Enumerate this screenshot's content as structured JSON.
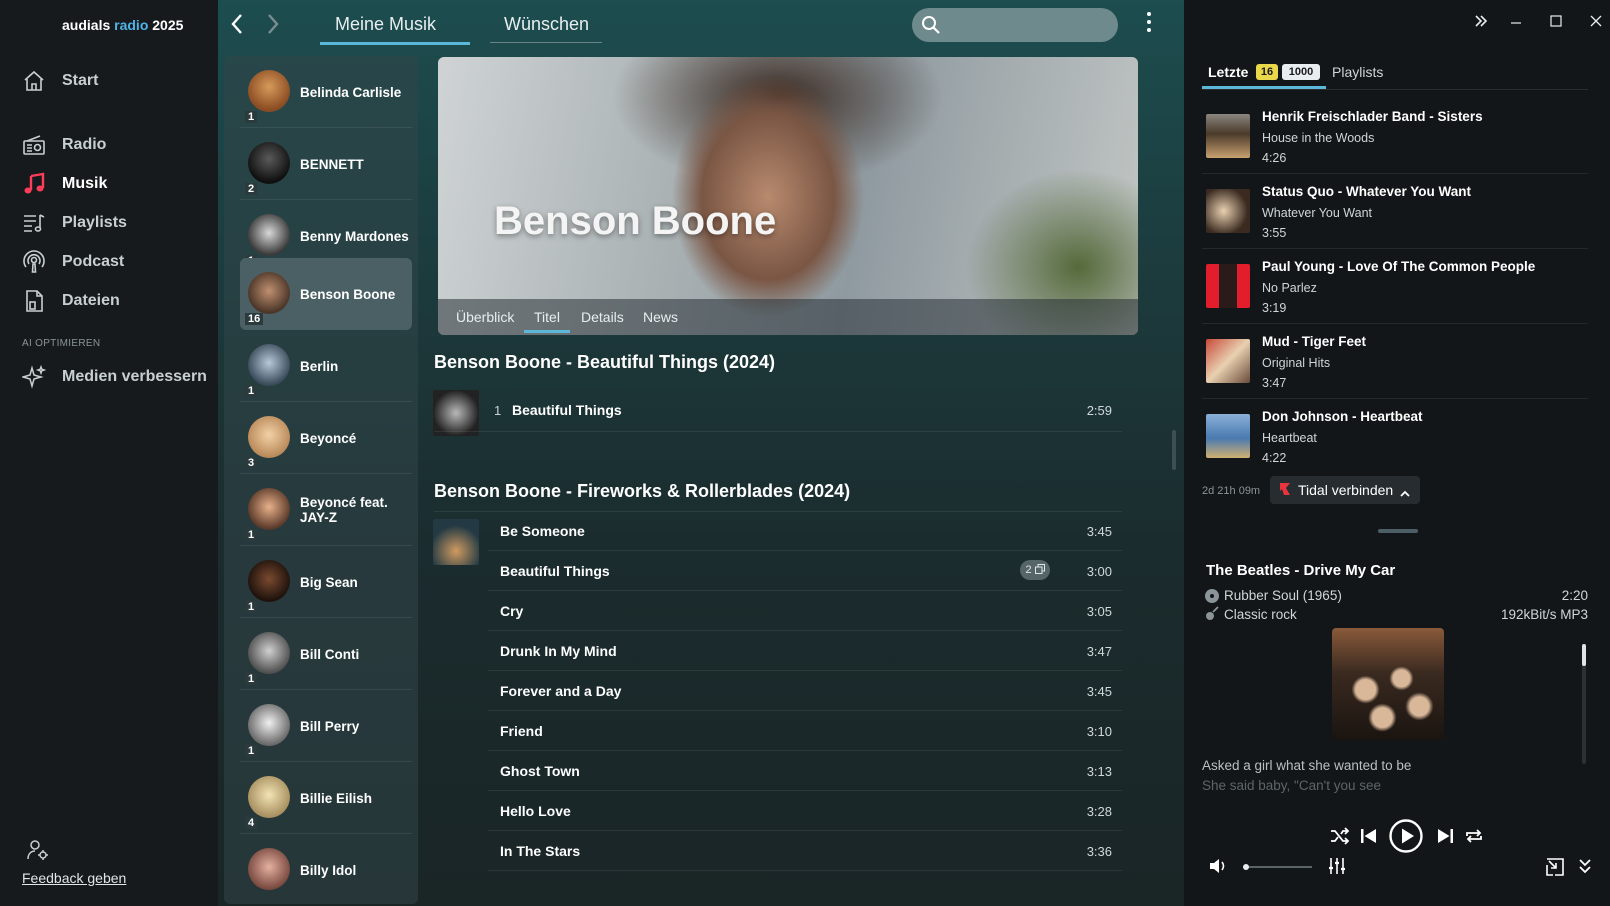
{
  "app": {
    "brand_prefix": "audials",
    "brand_accent": "radio",
    "brand_suffix": "2025"
  },
  "leftnav": {
    "items": [
      {
        "label": "Start",
        "icon": "home-icon"
      },
      {
        "label": "Radio",
        "icon": "radio-icon"
      },
      {
        "label": "Musik",
        "icon": "music-note-icon"
      },
      {
        "label": "Playlists",
        "icon": "playlist-icon"
      },
      {
        "label": "Podcast",
        "icon": "podcast-icon"
      },
      {
        "label": "Dateien",
        "icon": "files-icon"
      }
    ],
    "section_label": "AI OPTIMIEREN",
    "optimize_label": "Medien verbessern",
    "feedback_label": "Feedback geben"
  },
  "topbar": {
    "tab_music": "Meine Musik",
    "tab_wishes": "Wünschen"
  },
  "artists": [
    {
      "name": "Belinda Carlisle",
      "count": "1"
    },
    {
      "name": "BENNETT",
      "count": "2"
    },
    {
      "name": "Benny Mardones",
      "count": "1"
    },
    {
      "name": "Benson Boone",
      "count": "16"
    },
    {
      "name": "Berlin",
      "count": "1"
    },
    {
      "name": "Beyoncé",
      "count": "3"
    },
    {
      "name": "Beyoncé feat. JAY-Z",
      "count": "1"
    },
    {
      "name": "Big Sean",
      "count": "1"
    },
    {
      "name": "Bill Conti",
      "count": "1"
    },
    {
      "name": "Bill Perry",
      "count": "1"
    },
    {
      "name": "Billie Eilish",
      "count": "4"
    },
    {
      "name": "Billy Idol",
      "count": ""
    }
  ],
  "hero": {
    "title": "Benson Boone",
    "tabs": [
      "Überblick",
      "Titel",
      "Details",
      "News"
    ],
    "active_tab": "Titel"
  },
  "albums": [
    {
      "title": "Benson Boone - Beautiful Things  (2024)",
      "tracks": [
        {
          "num": "1",
          "title": "Beautiful Things",
          "duration": "2:59"
        }
      ]
    },
    {
      "title": "Benson Boone - Fireworks & Rollerblades  (2024)",
      "tracks": [
        {
          "title": "Be Someone",
          "duration": "3:45"
        },
        {
          "title": "Beautiful Things",
          "duration": "3:00",
          "badge": "2"
        },
        {
          "title": "Cry",
          "duration": "3:05"
        },
        {
          "title": "Drunk In My Mind",
          "duration": "3:47"
        },
        {
          "title": "Forever and a Day",
          "duration": "3:45"
        },
        {
          "title": "Friend",
          "duration": "3:10"
        },
        {
          "title": "Ghost Town",
          "duration": "3:13"
        },
        {
          "title": "Hello Love",
          "duration": "3:28"
        },
        {
          "title": "In The Stars",
          "duration": "3:36"
        }
      ]
    }
  ],
  "right": {
    "tab_recent": "Letzte",
    "pill_new": "16",
    "pill_total": "1000",
    "tab_playlists": "Playlists",
    "history": [
      {
        "title": "Henrik Freischlader Band - Sisters",
        "album": "House in the Woods",
        "duration": "4:26"
      },
      {
        "title": "Status Quo - Whatever You Want",
        "album": "Whatever You Want",
        "duration": "3:55"
      },
      {
        "title": "Paul Young - Love Of The Common People",
        "album": "No Parlez",
        "duration": "3:19"
      },
      {
        "title": "Mud - Tiger Feet",
        "album": "Original Hits",
        "duration": "3:47"
      },
      {
        "title": "Don Johnson - Heartbeat",
        "album": "Heartbeat",
        "duration": "4:22"
      }
    ],
    "ago": "2d 21h 09m",
    "tidal_label": "Tidal verbinden",
    "now_playing": {
      "title": "The Beatles -  Drive My Car",
      "album": "Rubber Soul  (1965)",
      "genre": "Classic rock",
      "duration": "2:20",
      "quality": "192kBit/s MP3",
      "lyrics_1": "Asked a girl what she wanted to be",
      "lyrics_2": "She said baby, \"Can't you see"
    },
    "volume": 0.05
  },
  "colors": {
    "accent_blue": "#4fb3e8",
    "music_red": "#ff3d5a",
    "tab_underline": "#5bb8d9",
    "pill_yellow": "#e8d84a"
  }
}
